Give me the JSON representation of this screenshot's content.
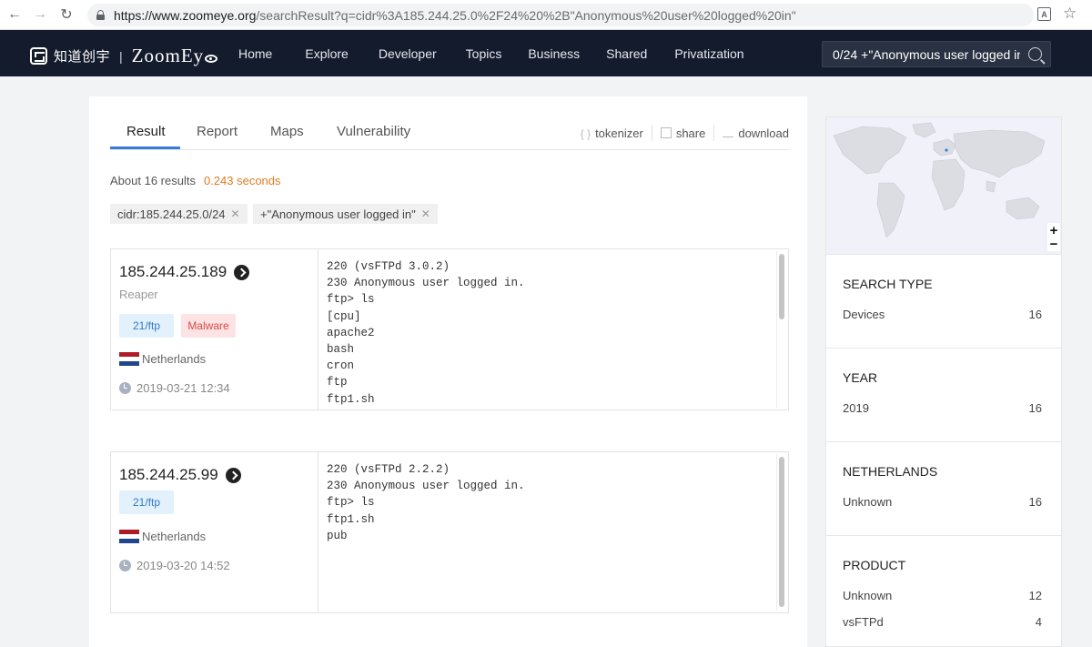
{
  "browser": {
    "url_host": "https://www.zoomeye.org",
    "url_path": "/searchResult?q=cidr%3A185.244.25.0%2F24%20%2B\"Anonymous%20user%20logged%20in\""
  },
  "header": {
    "logo_cn": "知道创宇",
    "logo_sep": "|",
    "logo_en": "ZoomEy",
    "nav": [
      "Home",
      "Explore",
      "Developer",
      "Topics",
      "Business",
      "Shared",
      "Privatization"
    ],
    "search_value": "0/24 +\"Anonymous user logged in\""
  },
  "tabs": [
    "Result",
    "Report",
    "Maps",
    "Vulnerability"
  ],
  "tools": {
    "tokenizer": "tokenizer",
    "share": "share",
    "download": "download"
  },
  "summary": {
    "count_text": "About 16 results",
    "time_text": "0.243 seconds"
  },
  "chips": [
    "cidr:185.244.25.0/24",
    "+\"Anonymous user logged in\""
  ],
  "results": [
    {
      "ip": "185.244.25.189",
      "hostname": "Reaper",
      "port": "21/ftp",
      "tag": "Malware",
      "country": "Netherlands",
      "date": "2019-03-21 12:34",
      "banner": "220 (vsFTPd 3.0.2)\n230 Anonymous user logged in.\nftp> ls\n[cpu]\napache2\nbash\ncron\nftp\nftp1.sh"
    },
    {
      "ip": "185.244.25.99",
      "port": "21/ftp",
      "country": "Netherlands",
      "date": "2019-03-20 14:52",
      "banner": "220 (vsFTPd 2.2.2)\n230 Anonymous user logged in.\nftp> ls\nftp1.sh\npub"
    }
  ],
  "map_controls": {
    "zoom_in": "+",
    "zoom_out": "−"
  },
  "facets": [
    {
      "title": "SEARCH TYPE",
      "rows": [
        {
          "label": "Devices",
          "count": "16"
        }
      ]
    },
    {
      "title": "YEAR",
      "rows": [
        {
          "label": "2019",
          "count": "16"
        }
      ]
    },
    {
      "title": "NETHERLANDS",
      "rows": [
        {
          "label": "Unknown",
          "count": "16"
        }
      ]
    },
    {
      "title": "PRODUCT",
      "rows": [
        {
          "label": "Unknown",
          "count": "12"
        },
        {
          "label": "vsFTPd",
          "count": "4"
        }
      ]
    }
  ],
  "colors": {
    "header_bg": "#141b2d",
    "accent": "#3a7bd5",
    "time": "#e07b24",
    "malware": "#d94a4a",
    "port": "#2f7cc4"
  },
  "icons": [
    "back-arrow-icon",
    "forward-arrow-icon",
    "reload-icon",
    "lock-icon",
    "translate-icon",
    "star-icon",
    "search-icon",
    "arrow-circle-icon",
    "clock-icon",
    "netherlands-flag-icon"
  ]
}
